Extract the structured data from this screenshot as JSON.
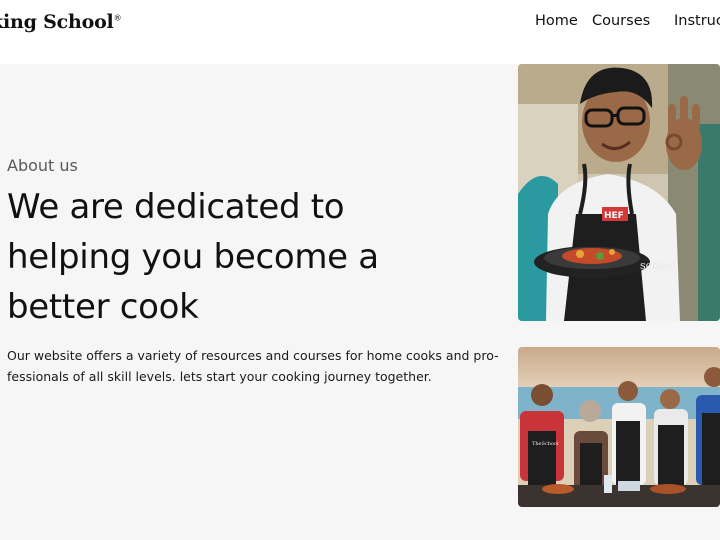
{
  "header": {
    "logo_text": "king School",
    "logo_mark": "®",
    "nav": [
      {
        "label": "Home"
      },
      {
        "label": "Courses"
      },
      {
        "label": "Instruc"
      }
    ]
  },
  "hero": {
    "eyebrow": "About us",
    "headline": "We are dedicated to helping you become a better cook",
    "description": "Our website offers a variety of resources and courses for home cooks and pro-fessionals of all skill levels. lets start your cooking journey together."
  },
  "images": {
    "top": {
      "apron_text": "school",
      "shirt_text": "HEF"
    },
    "bottom": {
      "apron_text": "TheSchool"
    }
  }
}
